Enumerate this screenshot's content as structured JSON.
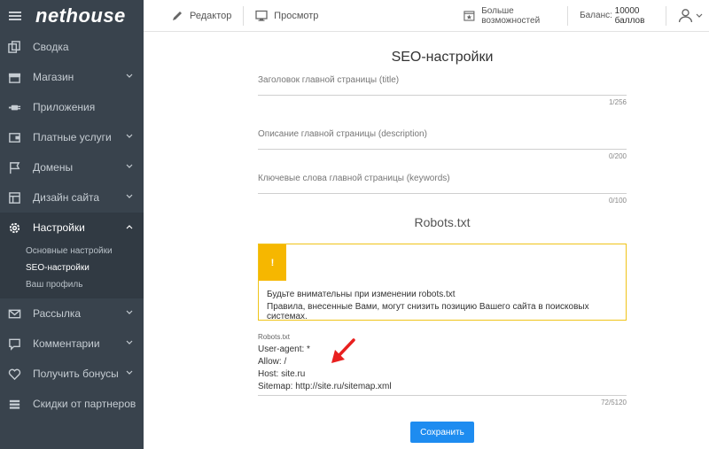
{
  "sidebar": {
    "logo": "nethouse",
    "items": [
      {
        "label": "Сводка",
        "icon": "copy-icon"
      },
      {
        "label": "Магазин",
        "icon": "shop-icon"
      },
      {
        "label": "Приложения",
        "icon": "plug-icon"
      },
      {
        "label": "Платные услуги",
        "icon": "wallet-icon"
      },
      {
        "label": "Домены",
        "icon": "flag-icon"
      },
      {
        "label": "Дизайн сайта",
        "icon": "layout-icon"
      },
      {
        "label": "Настройки",
        "icon": "gear-icon"
      },
      {
        "label": "Рассылка",
        "icon": "mail-icon"
      },
      {
        "label": "Комментарии",
        "icon": "chat-icon"
      },
      {
        "label": "Получить бонусы",
        "icon": "heart-icon"
      },
      {
        "label": "Скидки от партнеров",
        "icon": "list-icon"
      }
    ],
    "submenu": [
      "Основные настройки",
      "SEO-настройки",
      "Ваш профиль"
    ]
  },
  "topbar": {
    "editor": "Редактор",
    "preview": "Просмотр",
    "more": "Больше возможностей",
    "balance_label": "Баланс:",
    "balance_value": "10000 баллов"
  },
  "main": {
    "title": "SEO-настройки",
    "fields": [
      {
        "label": "Заголовок главной страницы (title)",
        "counter": "1/256"
      },
      {
        "label": "Описание главной страницы (description)",
        "counter": "0/200"
      },
      {
        "label": "Ключевые слова главной страницы (keywords)",
        "counter": "0/100"
      }
    ],
    "robots_title": "Robots.txt",
    "warning": {
      "mark": "!",
      "line1": "Будьте внимательны при изменении robots.txt",
      "line2": "Правила, внесенные Вами, могут снизить позицию Вашего сайта в поисковых системах."
    },
    "robots": {
      "label": "Robots.txt",
      "lines": [
        "User-agent: *",
        "Allow: /",
        "Host: site.ru",
        "Sitemap: http://site.ru/sitemap.xml"
      ],
      "counter": "72/5120"
    },
    "save_label": "Сохранить"
  },
  "colors": {
    "accent": "#1e8cf0",
    "warning": "#f6b700",
    "sidebar": "#39434d",
    "arrow": "#e8201f"
  }
}
